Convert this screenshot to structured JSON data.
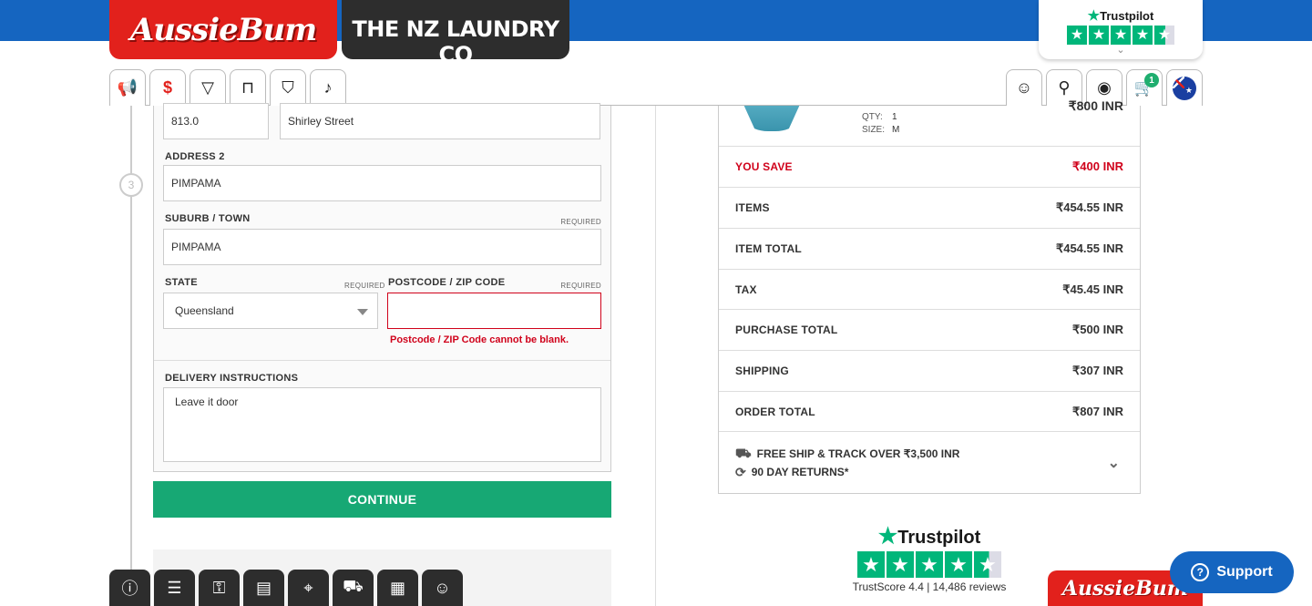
{
  "header": {
    "brand_primary": "AussieBum",
    "brand_secondary": "THE NZ LAUNDRY CO",
    "trustpilot": "Trustpilot",
    "trustpilot_rating_stars": 4.5
  },
  "nav": {
    "cart_count": "1",
    "icons_left": [
      "megaphone-icon",
      "sale-tag-icon",
      "underwear-brief-icon",
      "trunk-icon",
      "tshirt-icon",
      "socks-icon"
    ],
    "icons_right": [
      "community-icon",
      "search-icon",
      "account-icon",
      "cart-icon",
      "australia-flag-icon"
    ]
  },
  "form": {
    "step_number": "3",
    "street_number": "813.0",
    "street_name": "Shirley Street",
    "address2_label": "ADDRESS 2",
    "address2_value": "PIMPAMA",
    "suburb_label": "SUBURB / TOWN",
    "suburb_required": "REQUIRED",
    "suburb_value": "PIMPAMA",
    "state_label": "STATE",
    "state_required": "REQUIRED",
    "state_value": "Queensland",
    "postcode_label": "POSTCODE / ZIP CODE",
    "postcode_required": "REQUIRED",
    "postcode_value": "",
    "postcode_error": "Postcode / ZIP Code cannot be blank.",
    "delivery_label": "DELIVERY INSTRUCTIONS",
    "delivery_value": "Leave it door",
    "continue_label": "CONTINUE"
  },
  "summary": {
    "product": {
      "qty_label": "QTY:",
      "qty_value": "1",
      "size_label": "SIZE:",
      "size_value": "M",
      "price": "₹800 INR"
    },
    "rows": [
      {
        "label": "YOU SAVE",
        "value": "₹400 INR"
      },
      {
        "label": "ITEMS",
        "value": "₹454.55 INR"
      },
      {
        "label": "ITEM TOTAL",
        "value": "₹454.55 INR"
      },
      {
        "label": "TAX",
        "value": "₹45.45 INR"
      },
      {
        "label": "PURCHASE TOTAL",
        "value": "₹500 INR"
      },
      {
        "label": "SHIPPING",
        "value": "₹307 INR"
      },
      {
        "label": "ORDER TOTAL",
        "value": "₹807 INR"
      }
    ],
    "free_ship": "FREE SHIP & TRACK OVER ₹3,500 INR",
    "returns": "90 DAY RETURNS*"
  },
  "trustpilot_bottom": {
    "name": "Trustpilot",
    "score_text": "TrustScore 4.4 | 14,486 reviews"
  },
  "support_label": "Support",
  "footer_icons": [
    "info-icon",
    "faq-icon",
    "secure-account-icon",
    "order-list-icon",
    "location-icon",
    "delivery-truck-icon",
    "gift-card-icon",
    "customer-service-icon"
  ],
  "colors": {
    "brand_blue": "#1565c0",
    "brand_red": "#e2211c",
    "accent_green": "#17a874",
    "error_red": "#d0021b",
    "trustpilot_green": "#00b67a"
  }
}
